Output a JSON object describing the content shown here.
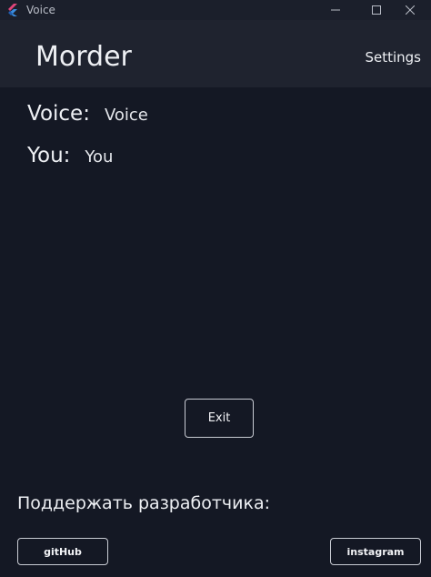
{
  "window": {
    "title": "Voice"
  },
  "header": {
    "brand": "Morder",
    "settings_label": "Settings"
  },
  "voice_row": {
    "label": "Voice:",
    "value": "Voice"
  },
  "you_row": {
    "label": "You:",
    "value": "You"
  },
  "exit_label": "Exit",
  "support": {
    "label": "Поддержать разработчика:",
    "github_label": "gitHub",
    "instagram_label": "instagram"
  },
  "colors": {
    "background": "#141824",
    "header": "#1f232f",
    "titlebar": "#1b1f2b",
    "text": "#eef0f4",
    "button_border": "#c9ccd4"
  },
  "icons": {
    "app": "flutter-logo-icon",
    "minimize": "minimize-icon",
    "maximize": "maximize-icon",
    "close": "close-icon"
  }
}
